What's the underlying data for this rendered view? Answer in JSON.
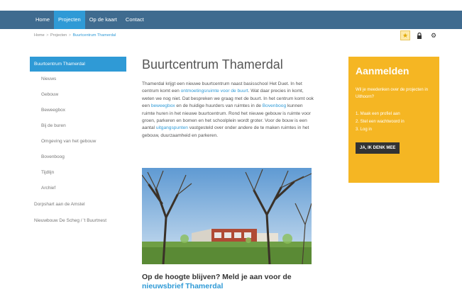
{
  "nav": {
    "items": [
      {
        "label": "Home"
      },
      {
        "label": "Projecten"
      },
      {
        "label": "Op de kaart"
      },
      {
        "label": "Contact"
      }
    ]
  },
  "breadcrumb": {
    "home": "Home",
    "sep": ">",
    "projects": "Projecten",
    "current": "Buurtcentrum Thamerdal"
  },
  "tools": {
    "star_icon": "star-icon",
    "lock_icon": "lock-icon",
    "gear_icon": "gear-icon"
  },
  "sidebar": {
    "active": "Buurtcentrum Thamerdal",
    "sub_items": [
      {
        "label": "Nieuws"
      },
      {
        "label": "Gebouw"
      },
      {
        "label": "Beweegbox"
      },
      {
        "label": "Bij de buren"
      },
      {
        "label": "Omgeving van het gebouw"
      },
      {
        "label": "Bovenboog"
      },
      {
        "label": "Tijdlijn"
      },
      {
        "label": "Archief"
      }
    ],
    "top_items": [
      {
        "label": "Dorpshart aan de Amstel"
      },
      {
        "label": "Nieuwbouw De Scheg / 't Buurtnest"
      }
    ]
  },
  "main": {
    "title": "Buurtcentrum Thamerdal",
    "p1": "Thamerdal krijgt een nieuwe buurtcentrum naast basisschool Het Duet. In het centrum komt een ",
    "link1": "ontmoetingsruimte voor de buurt",
    "p2": ". Wat daar precies in komt, weten we nog niet. Dat bespreken we graag met de buurt. In het centrum komt ook een ",
    "link2": "beweegbox",
    "p3": " en de huidige huurders van ruimtes in de ",
    "link3": "Bovenboog",
    "p4": " kunnen ruimte huren in het nieuwe buurtcentrum. Rond het nieuwe gebouw is ruimte voor groen, parkeren en bomen en het schoolplein wordt groter. Voor de bouw is een aantal ",
    "link4": "uitgangspunten",
    "p5": " vastgesteld over onder andere de te maken ruimtes in het gebouw, duurzaamheid en parkeren.",
    "news_text": "Op de hoogte blijven? Meld je aan voor de",
    "news_link": "nieuwsbrief Thamerdal"
  },
  "signup": {
    "title": "Aanmelden",
    "question": "Wil je meedenken over de projecten in Uithoorn?",
    "step1": "1. Maak een profiel aan",
    "step2": "2. Stel een wachtwoord in",
    "step3": "3. Log in",
    "button": "JA, IK DENK MEE"
  },
  "colors": {
    "nav_bg": "#3f6b8f",
    "accent": "#2f9ad6",
    "signup_bg": "#f5b623"
  }
}
